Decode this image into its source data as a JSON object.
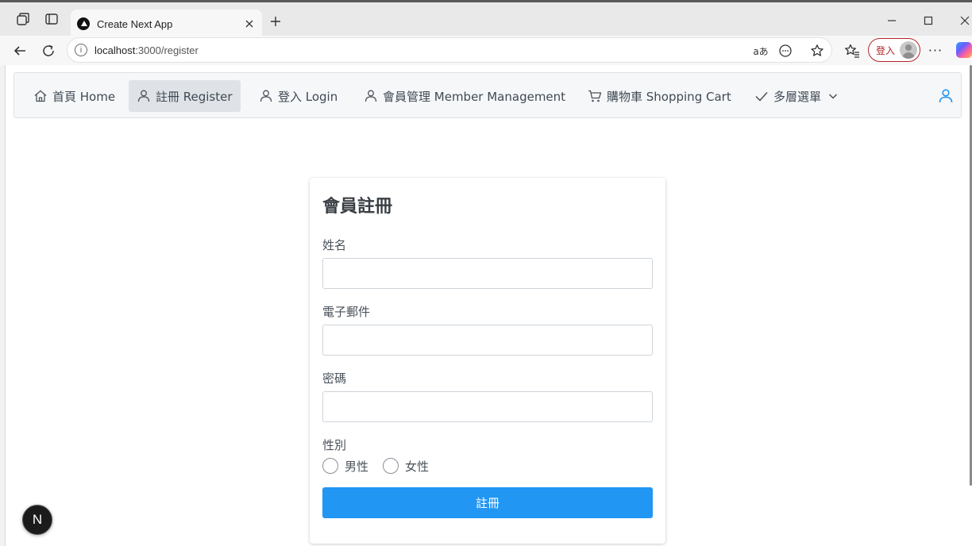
{
  "browser": {
    "tab_title": "Create Next App",
    "url_host": "localhost",
    "url_path": ":3000/register",
    "read_aloud_label": "aあ",
    "profile_label": "登入",
    "more_label": "···",
    "icons": [
      "workspaces-icon",
      "tab-actions-icon",
      "nextjs-favicon-icon",
      "close-icon",
      "plus-icon",
      "minimize-icon",
      "maximize-icon",
      "window-close-icon",
      "back-arrow-icon",
      "refresh-icon",
      "info-icon",
      "read-aloud-icon",
      "more-circle-icon",
      "star-icon",
      "favorites-icon",
      "profile-avatar-icon",
      "copilot-icon"
    ]
  },
  "navbar": {
    "items": [
      {
        "label": "首頁 Home",
        "icon": "home-icon"
      },
      {
        "label": "註冊 Register",
        "icon": "user-icon",
        "active": true
      },
      {
        "label": "登入 Login",
        "icon": "user-icon"
      },
      {
        "label": "會員管理 Member Management",
        "icon": "user-icon"
      },
      {
        "label": "購物車 Shopping Cart",
        "icon": "cart-icon"
      },
      {
        "label": "多層選單",
        "icon": "check-icon",
        "dropdown": true
      }
    ],
    "user_icon": "user-icon"
  },
  "form": {
    "title": "會員註冊",
    "name_label": "姓名",
    "name_value": "",
    "email_label": "電子郵件",
    "email_value": "",
    "password_label": "密碼",
    "password_value": "",
    "gender_label": "性別",
    "gender_options": [
      "男性",
      "女性"
    ],
    "submit_label": "註冊"
  },
  "dev_badge": {
    "label": "N"
  },
  "colors": {
    "primary": "#2196f3",
    "navbar_bg": "#f6f7f9",
    "nav_active_bg": "#dfe3e7",
    "nav_user_icon": "#2196f3",
    "profile_border": "#b3262b"
  }
}
